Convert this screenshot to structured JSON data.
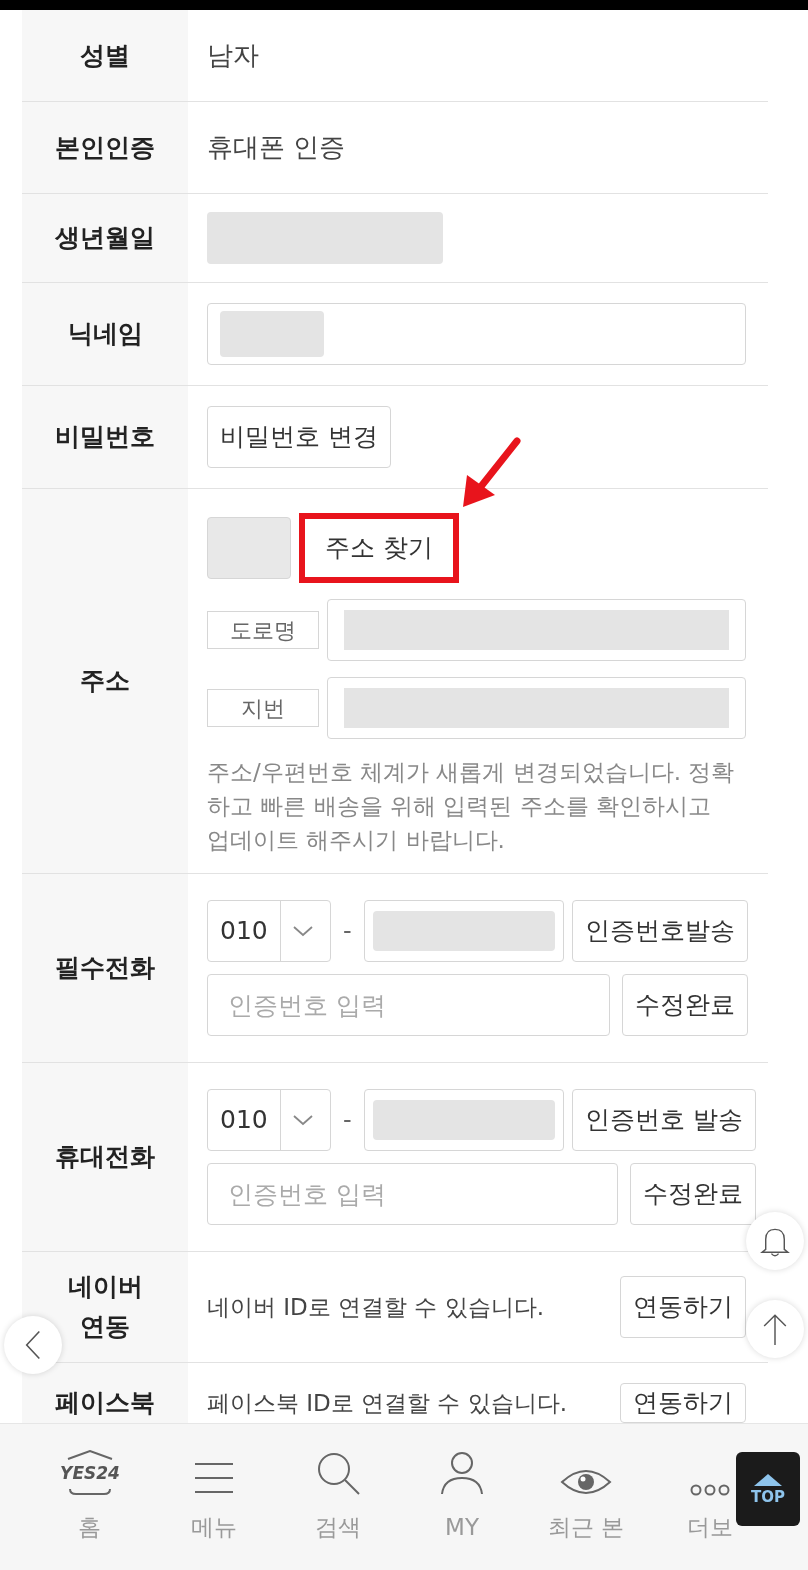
{
  "rows": [
    {
      "kind": "text",
      "label": "성별",
      "value": "남자"
    },
    {
      "kind": "text",
      "label": "본인인증",
      "value": "휴대폰 인증"
    },
    {
      "kind": "redacted",
      "label": "생년월일"
    },
    {
      "kind": "input",
      "label": "닉네임"
    },
    {
      "kind": "button",
      "label": "비밀번호",
      "button": "비밀번호 변경"
    },
    {
      "kind": "address",
      "label": "주소",
      "search_button": "주소 찾기",
      "search_highlighted": true,
      "road_label": "도로명",
      "lot_label": "지번",
      "notice": "주소/우편번호 체계가 새롭게 변경되었습니다. 정확하고 빠른 배송을 위해 입력된 주소를 확인하시고 업데이트 해주시기 바랍니다."
    },
    {
      "kind": "phone",
      "label": "필수전화",
      "prefix": "010",
      "dash": "-",
      "send_button": "인증번호발송",
      "code_placeholder": "인증번호 입력",
      "confirm_button": "수정완료"
    },
    {
      "kind": "phone",
      "label": "휴대전화",
      "prefix": "010",
      "dash": "-",
      "send_button": "인증번호 발송",
      "code_placeholder": "인증번호 입력",
      "confirm_button": "수정완료"
    },
    {
      "kind": "link",
      "label": "네이버 연동",
      "text": "네이버 ID로 연결할 수 있습니다.",
      "button": "연동하기"
    },
    {
      "kind": "link",
      "label": "페이스북",
      "text": "페이스북 ID로 연결할 수 있습니다.",
      "button": "연동하기"
    }
  ],
  "nav": [
    {
      "logo": "YES24",
      "label": "홈"
    },
    {
      "label": "메뉴"
    },
    {
      "label": "검색"
    },
    {
      "label": "MY"
    },
    {
      "label": "최근 본"
    },
    {
      "label": "더보"
    }
  ],
  "top_button": "TOP"
}
